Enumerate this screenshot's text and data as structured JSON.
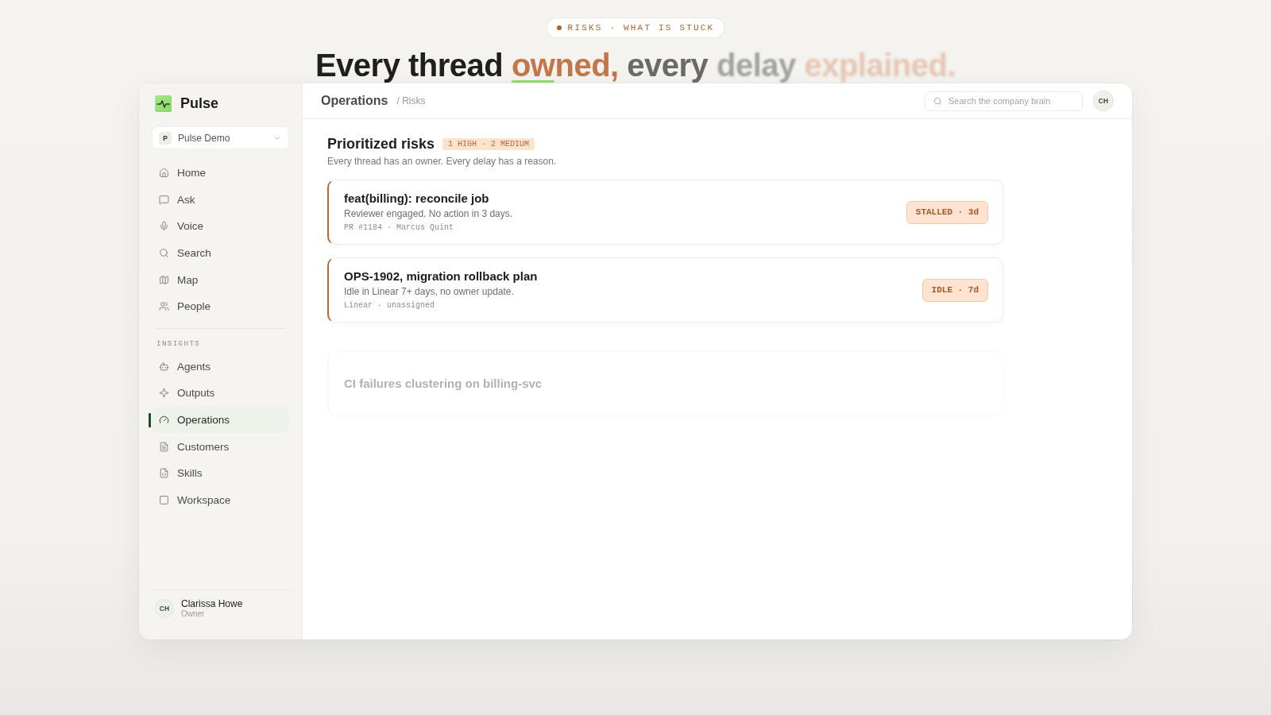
{
  "eyebrow": {
    "text": "RISKS · WHAT IS STUCK"
  },
  "headline": {
    "words": [
      {
        "text": "Every thread",
        "kind": "plain",
        "underlined": false
      },
      {
        "text": "owned,",
        "kind": "accent",
        "underlined": true
      },
      {
        "text": "every",
        "kind": "muted",
        "underlined": false
      },
      {
        "text": "delay",
        "kind": "faded",
        "underlined": false
      },
      {
        "text": "explained.",
        "kind": "ghost",
        "underlined": false
      }
    ]
  },
  "sidebar": {
    "brand": "Pulse",
    "workspace": {
      "initial": "P",
      "name": "Pulse Demo"
    },
    "items": [
      {
        "label": "Home",
        "selected": false
      },
      {
        "label": "Ask",
        "selected": false
      },
      {
        "label": "Voice",
        "selected": false
      },
      {
        "label": "Search",
        "selected": false
      },
      {
        "label": "Map",
        "selected": false
      },
      {
        "label": "People",
        "selected": false
      }
    ],
    "sections": [
      {
        "label": "INSIGHTS",
        "items": [
          {
            "label": "Agents",
            "selected": false
          },
          {
            "label": "Outputs",
            "selected": false
          },
          {
            "label": "Operations",
            "selected": true
          },
          {
            "label": "Customers",
            "selected": false
          },
          {
            "label": "Skills",
            "selected": false
          },
          {
            "label": "Workspace",
            "selected": false
          }
        ]
      }
    ],
    "user": {
      "initials": "CH",
      "name": "Clarissa Howe",
      "role": "Owner"
    }
  },
  "header": {
    "title": "Operations",
    "crumb": "/ Risks",
    "search": {
      "placeholder": "Search the company brain"
    },
    "avatar": "CH"
  },
  "risks": {
    "title": "Prioritized risks",
    "badge": "1 HIGH · 2 MEDIUM",
    "subtitle": "Every thread has an owner. Every delay has a reason.",
    "cards": [
      {
        "title": "feat(billing): reconcile job",
        "description": "Reviewer engaged. No action in 3 days.",
        "meta": "PR #1184 · Marcus Quint",
        "status": "STALLED · 3d",
        "faded": false
      },
      {
        "title": "OPS-1902, migration rollback plan",
        "description": "Idle in Linear 7+ days, no owner update.",
        "meta": "Linear · unassigned",
        "status": "IDLE · 7d",
        "faded": false
      },
      {
        "title": "CI failures clustering on billing-svc",
        "faded": true
      }
    ]
  }
}
